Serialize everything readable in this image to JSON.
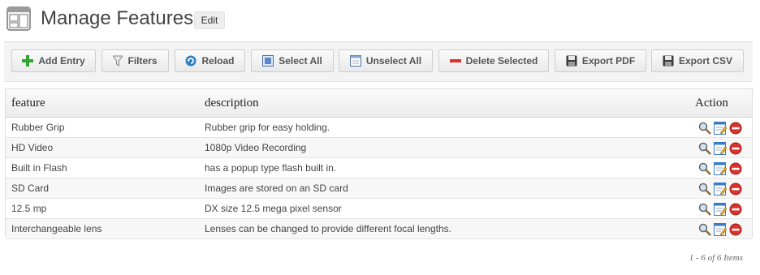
{
  "header": {
    "title": "Manage Features",
    "edit_label": "Edit",
    "icon": "window-layout-icon"
  },
  "toolbar": {
    "buttons": [
      {
        "label": "Add Entry",
        "icon": "plus-icon"
      },
      {
        "label": "Filters",
        "icon": "funnel-icon"
      },
      {
        "label": "Reload",
        "icon": "reload-icon"
      },
      {
        "label": "Select All",
        "icon": "select-all-icon"
      },
      {
        "label": "Unselect All",
        "icon": "unselect-all-icon"
      },
      {
        "label": "Delete Selected",
        "icon": "minus-icon"
      },
      {
        "label": "Export PDF",
        "icon": "floppy-disk-icon"
      },
      {
        "label": "Export CSV",
        "icon": "floppy-disk-icon"
      }
    ]
  },
  "table": {
    "columns": [
      "feature",
      "description",
      "Action"
    ],
    "rows": [
      {
        "feature": "Rubber Grip",
        "description": "Rubber grip for easy holding."
      },
      {
        "feature": "HD Video",
        "description": "1080p Video Recording"
      },
      {
        "feature": "Built in Flash",
        "description": "has a popup type flash built in."
      },
      {
        "feature": "SD Card",
        "description": "Images are stored on an SD card"
      },
      {
        "feature": "12.5 mp",
        "description": "DX size 12.5 mega pixel sensor"
      },
      {
        "feature": "Interchangeable lens",
        "description": "Lenses can be changed to provide different focal lengths."
      }
    ],
    "row_action_icons": [
      "magnifier-view-icon",
      "edit-icon",
      "delete-icon"
    ]
  },
  "pager": {
    "text": "1 - 6 of 6 Items"
  },
  "colors": {
    "add_green": "#2fa52f",
    "delete_red": "#d9312b",
    "reload_blue": "#2a7ec4",
    "toolbar_bg": "#f3f3f3"
  }
}
